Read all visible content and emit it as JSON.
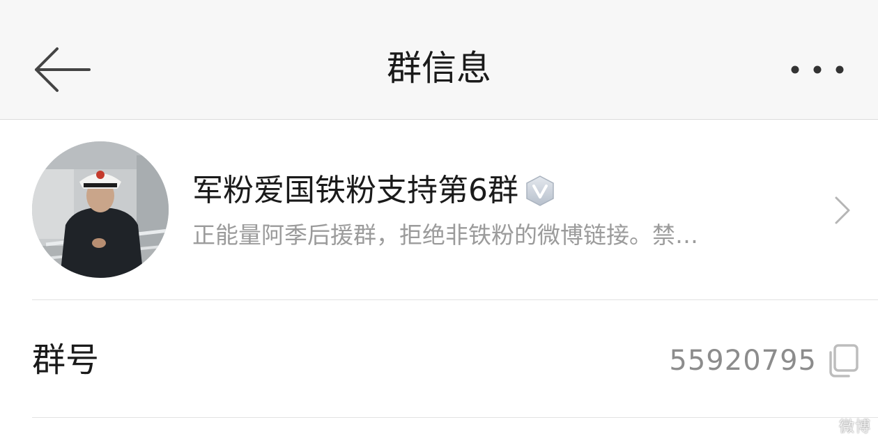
{
  "header": {
    "title": "群信息",
    "back_icon": "arrow-left-icon",
    "more_icon": "more-horizontal-icon"
  },
  "group": {
    "name": "军粉爱国铁粉支持第6群",
    "description": "正能量阿季后援群，拒绝非铁粉的微博链接。禁…",
    "badge_icon": "verified-v-icon",
    "avatar_description": "avatar-photo"
  },
  "group_number": {
    "label": "群号",
    "value": "55920795",
    "copy_icon": "copy-icon"
  },
  "watermark": {
    "text": "微博"
  },
  "colors": {
    "header_bg": "#f7f7f7",
    "primary_text": "#1a1a1a",
    "secondary_text": "#9b9b9b",
    "divider": "#e2e2e2"
  }
}
